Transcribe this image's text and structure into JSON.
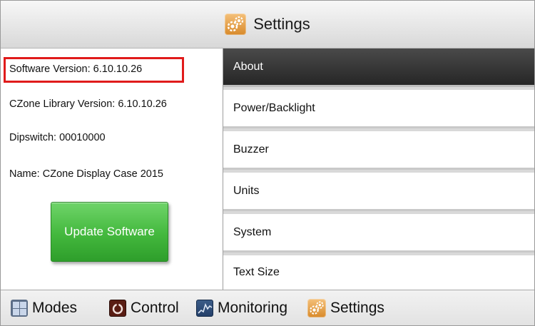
{
  "header": {
    "title": "Settings",
    "icon": "settings-gear-icon"
  },
  "info": {
    "software_version": "Software Version: 6.10.10.26",
    "czone_library_version": "CZone Library Version: 6.10.10.26",
    "dipswitch": "Dipswitch: 00010000",
    "name": "Name: CZone Display Case 2015"
  },
  "update_button": {
    "label": "Update Software",
    "color": "#43b83d"
  },
  "highlight": {
    "color": "#e01b1b"
  },
  "menu": {
    "items": [
      {
        "label": "About",
        "active": true
      },
      {
        "label": "Power/Backlight",
        "active": false
      },
      {
        "label": "Buzzer",
        "active": false
      },
      {
        "label": "Units",
        "active": false
      },
      {
        "label": "System",
        "active": false
      },
      {
        "label": "Text Size",
        "active": false
      }
    ]
  },
  "bottom_nav": {
    "items": [
      {
        "label": "Modes",
        "icon": "modes-grid-icon"
      },
      {
        "label": "Control",
        "icon": "control-power-icon"
      },
      {
        "label": "Monitoring",
        "icon": "monitoring-graph-icon"
      },
      {
        "label": "Settings",
        "icon": "settings-gear-icon"
      }
    ]
  }
}
